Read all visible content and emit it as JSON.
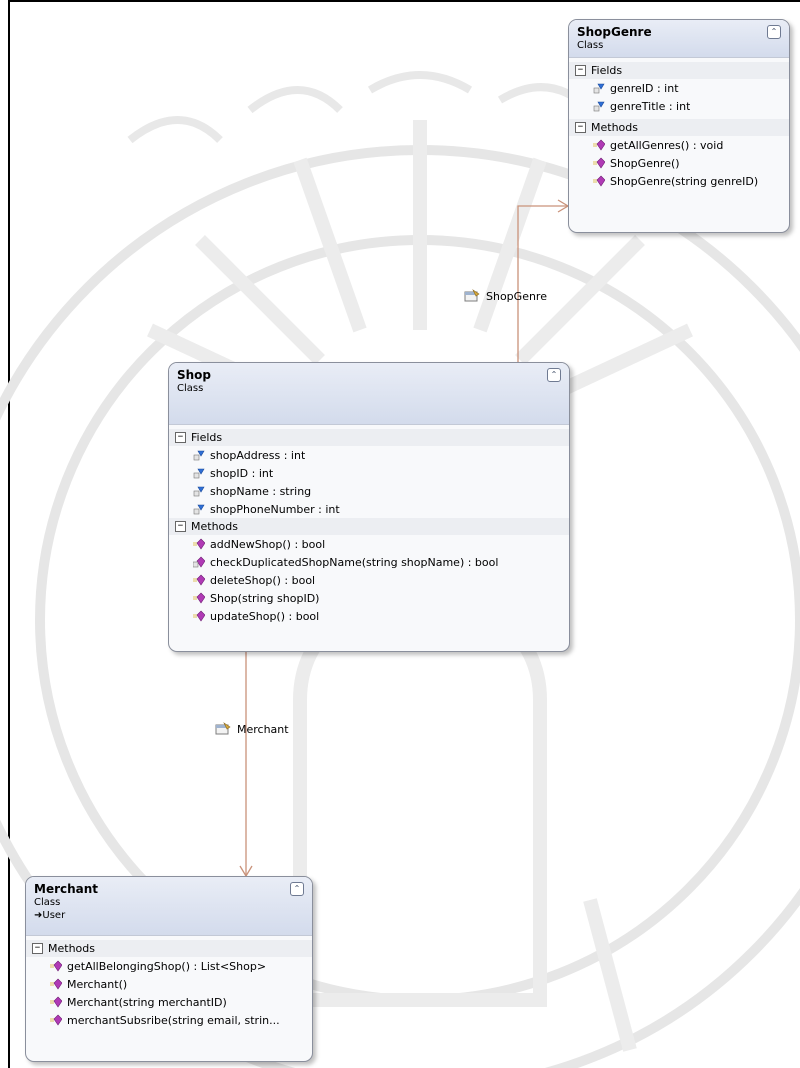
{
  "classes": {
    "shopgenre": {
      "name": "ShopGenre",
      "kind": "Class",
      "fields_title": "Fields",
      "fields": [
        "genreID : int",
        "genreTitle : int"
      ],
      "methods_title": "Methods",
      "methods": [
        "getAllGenres() : void",
        "ShopGenre()",
        "ShopGenre(string genreID)"
      ]
    },
    "shop": {
      "name": "Shop",
      "kind": "Class",
      "fields_title": "Fields",
      "fields": [
        "shopAddress : int",
        "shopID : int",
        "shopName : string",
        "shopPhoneNumber : int"
      ],
      "methods_title": "Methods",
      "methods": [
        "addNewShop() : bool",
        "checkDuplicatedShopName(string shopName) : bool",
        "deleteShop() : bool",
        "Shop(string shopID)",
        "updateShop() : bool"
      ]
    },
    "merchant": {
      "name": "Merchant",
      "kind": "Class",
      "base": "User",
      "methods_title": "Methods",
      "methods": [
        "getAllBelongingShop() : List<Shop>",
        "Merchant()",
        "Merchant(string merchantID)",
        "merchantSubsribe(string email,  strin..."
      ]
    }
  },
  "associations": {
    "shop_to_genre": "ShopGenre",
    "shop_to_merchant": "Merchant"
  },
  "colors": {
    "connector": "#c9927a",
    "header": "#d3dbec",
    "method_icon": "#b03ab5",
    "field_icon": "#2f6fd6"
  }
}
